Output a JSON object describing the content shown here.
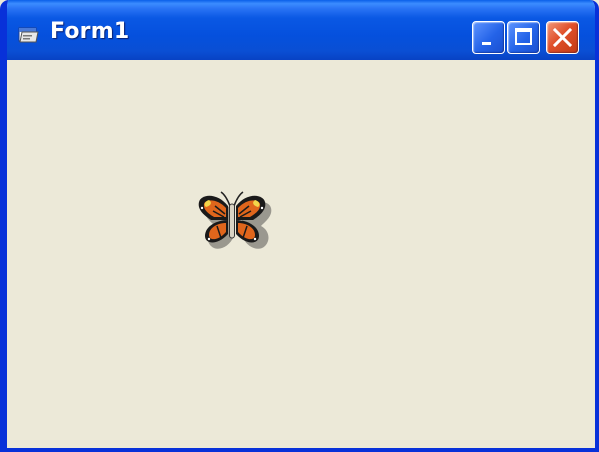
{
  "window": {
    "title": "Form1",
    "title_icon": "form-icon",
    "buttons": {
      "minimize": "minimize-icon",
      "maximize": "maximize-icon",
      "close": "close-icon"
    },
    "colors": {
      "titlebar": "#0a58e4",
      "frame": "#0831d9",
      "client_background": "#ece9d8",
      "close_button": "#e0502a"
    }
  },
  "client": {
    "image": "butterfly-icon"
  }
}
